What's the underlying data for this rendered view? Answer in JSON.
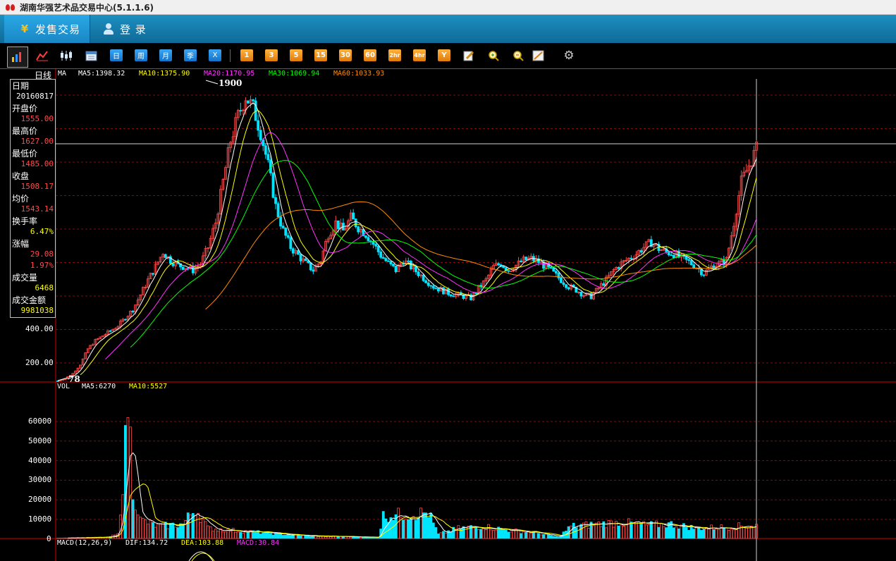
{
  "window": {
    "title": "湖南华强艺术品交易中心(5.1.1.6)"
  },
  "nav": {
    "tab_issue": "发售交易",
    "tab_login": "登  录"
  },
  "toolbar": {
    "period_buttons": [
      "日",
      "周",
      "月",
      "季",
      "X"
    ],
    "minute_buttons": [
      "1",
      "3",
      "5",
      "15",
      "30",
      "60",
      "2hr",
      "4hr",
      "Y"
    ]
  },
  "chart_header": {
    "period": "日线",
    "ma_label": "MA",
    "ma5": "MA5:1398.32",
    "ma10": "MA10:1375.90",
    "ma20": "MA20:1170.95",
    "ma30": "MA30:1069.94",
    "ma60": "MA60:1033.93"
  },
  "info": {
    "date_label": "日期",
    "date": "20160817",
    "open_label": "开盘价",
    "open": "1555.00",
    "high_label": "最高价",
    "high": "1627.00",
    "low_label": "最低价",
    "low": "1485.00",
    "close_label": "收盘",
    "close": "1508.17",
    "avg_label": "均价",
    "avg": "1543.14",
    "turnover_label": "换手率",
    "turnover": "6.47%",
    "change_label": "涨幅",
    "change_amt": "29.08",
    "change_pct": "1.97%",
    "volume_label": "成交量",
    "volume": "6468",
    "amount_label": "成交金额",
    "amount": "9981038"
  },
  "price_axis": {
    "ticks": [
      "400.00",
      "200.00"
    ]
  },
  "annotations": {
    "peak": "1900",
    "low": "78"
  },
  "volume_header": {
    "label": "VOL",
    "ma5": "MA5:6270",
    "ma10": "MA10:5527"
  },
  "volume_axis": {
    "ticks": [
      "60000",
      "50000",
      "40000",
      "30000",
      "20000",
      "10000",
      "0"
    ]
  },
  "macd_header": {
    "label": "MACD(12,26,9)",
    "dif": "DIF:134.72",
    "dea": "DEA:103.88",
    "macd": "MACD:30.84"
  },
  "colors": {
    "up": "#ff4a4a",
    "down": "#00e5ff",
    "ma5": "#ffffff",
    "ma10": "#ffff00",
    "ma20": "#ff33ff",
    "ma30": "#00ff00",
    "ma60": "#ff8c00",
    "grid": "#a00000",
    "axis": "#d40000"
  },
  "chart_data": {
    "type": "candlestick",
    "price_ylim": [
      78,
      1900
    ],
    "close_path": [
      [
        0,
        85
      ],
      [
        3,
        100
      ],
      [
        6,
        130
      ],
      [
        9,
        185
      ],
      [
        12,
        280
      ],
      [
        15,
        330
      ],
      [
        18,
        360
      ],
      [
        21,
        390
      ],
      [
        24,
        420
      ],
      [
        27,
        470
      ],
      [
        30,
        520
      ],
      [
        33,
        610
      ],
      [
        36,
        700
      ],
      [
        39,
        780
      ],
      [
        42,
        870
      ],
      [
        45,
        820
      ],
      [
        48,
        790
      ],
      [
        51,
        780
      ],
      [
        54,
        760
      ],
      [
        57,
        800
      ],
      [
        60,
        900
      ],
      [
        63,
        1050
      ],
      [
        66,
        1300
      ],
      [
        69,
        1550
      ],
      [
        72,
        1700
      ],
      [
        75,
        1820
      ],
      [
        78,
        1750
      ],
      [
        81,
        1600
      ],
      [
        84,
        1400
      ],
      [
        87,
        1150
      ],
      [
        90,
        1000
      ],
      [
        93,
        900
      ],
      [
        96,
        850
      ],
      [
        99,
        800
      ],
      [
        102,
        760
      ],
      [
        105,
        820
      ],
      [
        108,
        980
      ],
      [
        111,
        1050
      ],
      [
        114,
        1000
      ],
      [
        117,
        1080
      ],
      [
        120,
        1020
      ],
      [
        123,
        980
      ],
      [
        126,
        920
      ],
      [
        129,
        850
      ],
      [
        132,
        800
      ],
      [
        135,
        760
      ],
      [
        138,
        820
      ],
      [
        141,
        780
      ],
      [
        144,
        740
      ],
      [
        147,
        700
      ],
      [
        150,
        660
      ],
      [
        153,
        640
      ],
      [
        156,
        620
      ],
      [
        159,
        610
      ],
      [
        162,
        600
      ],
      [
        165,
        590
      ],
      [
        168,
        650
      ],
      [
        171,
        700
      ],
      [
        174,
        780
      ],
      [
        177,
        800
      ],
      [
        180,
        760
      ],
      [
        183,
        790
      ],
      [
        186,
        820
      ],
      [
        189,
        830
      ],
      [
        192,
        810
      ],
      [
        195,
        780
      ],
      [
        198,
        740
      ],
      [
        201,
        700
      ],
      [
        204,
        660
      ],
      [
        207,
        640
      ],
      [
        210,
        610
      ],
      [
        213,
        600
      ],
      [
        216,
        650
      ],
      [
        219,
        700
      ],
      [
        222,
        760
      ],
      [
        225,
        800
      ],
      [
        228,
        830
      ],
      [
        231,
        860
      ],
      [
        234,
        900
      ],
      [
        237,
        930
      ],
      [
        240,
        890
      ],
      [
        243,
        870
      ],
      [
        246,
        860
      ],
      [
        249,
        830
      ],
      [
        252,
        810
      ],
      [
        255,
        780
      ],
      [
        258,
        740
      ],
      [
        261,
        780
      ],
      [
        264,
        800
      ],
      [
        267,
        820
      ],
      [
        270,
        1050
      ],
      [
        273,
        1300
      ],
      [
        276,
        1400
      ],
      [
        279,
        1500
      ]
    ],
    "volume_ylim": [
      0,
      72000
    ],
    "volume_path": [
      [
        0,
        200
      ],
      [
        20,
        600
      ],
      [
        24,
        2000
      ],
      [
        27,
        44000
      ],
      [
        28,
        70000
      ],
      [
        30,
        25000
      ],
      [
        33,
        9000
      ],
      [
        40,
        6000
      ],
      [
        50,
        7000
      ],
      [
        55,
        15000
      ],
      [
        60,
        5000
      ],
      [
        70,
        4000
      ],
      [
        80,
        3000
      ],
      [
        90,
        2000
      ],
      [
        100,
        1200
      ],
      [
        110,
        1000
      ],
      [
        120,
        800
      ],
      [
        128,
        500
      ],
      [
        130,
        11000
      ],
      [
        140,
        12000
      ],
      [
        148,
        12500
      ],
      [
        152,
        2000
      ],
      [
        160,
        5000
      ],
      [
        170,
        6000
      ],
      [
        180,
        4000
      ],
      [
        190,
        3000
      ],
      [
        200,
        600
      ],
      [
        205,
        6000
      ],
      [
        215,
        7000
      ],
      [
        225,
        8000
      ],
      [
        235,
        6500
      ],
      [
        245,
        7000
      ],
      [
        255,
        5000
      ],
      [
        265,
        5500
      ],
      [
        279,
        6468
      ]
    ]
  }
}
